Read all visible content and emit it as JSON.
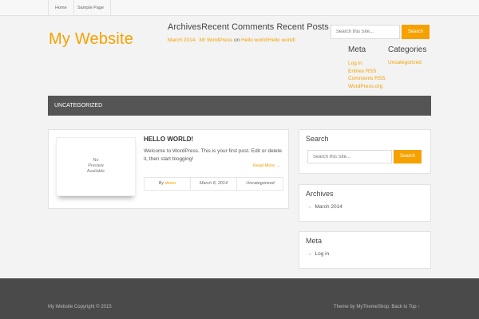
{
  "nav": {
    "items": [
      {
        "label": "Home"
      },
      {
        "label": "Sample Page"
      }
    ]
  },
  "header": {
    "site_title": "My Website",
    "widget_titles": "ArchivesRecent Comments Recent Posts",
    "archive_link": "March 2014",
    "comment_author": "Mr WordPress",
    "comment_on": " on ",
    "comment_post": "Hello world!",
    "recent_post": "Hello world!",
    "search": {
      "placeholder": "Search this Site...",
      "button": "Search"
    },
    "meta": {
      "title": "Meta",
      "links": [
        "Log in",
        "Entries RSS",
        "Comments RSS",
        "WordPress.org"
      ]
    },
    "categories": {
      "title": "Categories",
      "links": [
        "Uncategorized"
      ]
    }
  },
  "category_bar": {
    "label": "UNCATEGORIZED"
  },
  "post": {
    "thumb_text": [
      "No",
      "Preview",
      "Available"
    ],
    "title": "HELLO WORLD!",
    "excerpt": "Welcome to WordPress. This is your first post. Edit or delete it, then start blogging!",
    "read_more": "Read More →",
    "meta": {
      "by": "By ",
      "author": "demo",
      "date": "March 8, 2014",
      "category": "Uncategorized"
    }
  },
  "sidebar": {
    "search": {
      "title": "Search",
      "placeholder": "Search this Site...",
      "button": "Search"
    },
    "archives": {
      "title": "Archives",
      "item": "March 2014",
      "arrow": "→"
    },
    "meta": {
      "title": "Meta",
      "item": "Log in",
      "arrow": "→"
    }
  },
  "footer": {
    "copyright": "My Website Copyright © 2015",
    "theme_text": "Theme by MyThemeShop. ",
    "back_to_top": "Back to Top ↑"
  },
  "colors": {
    "accent": "#f5a100",
    "category_bar": "#555555",
    "footer": "#4a4a4a"
  }
}
